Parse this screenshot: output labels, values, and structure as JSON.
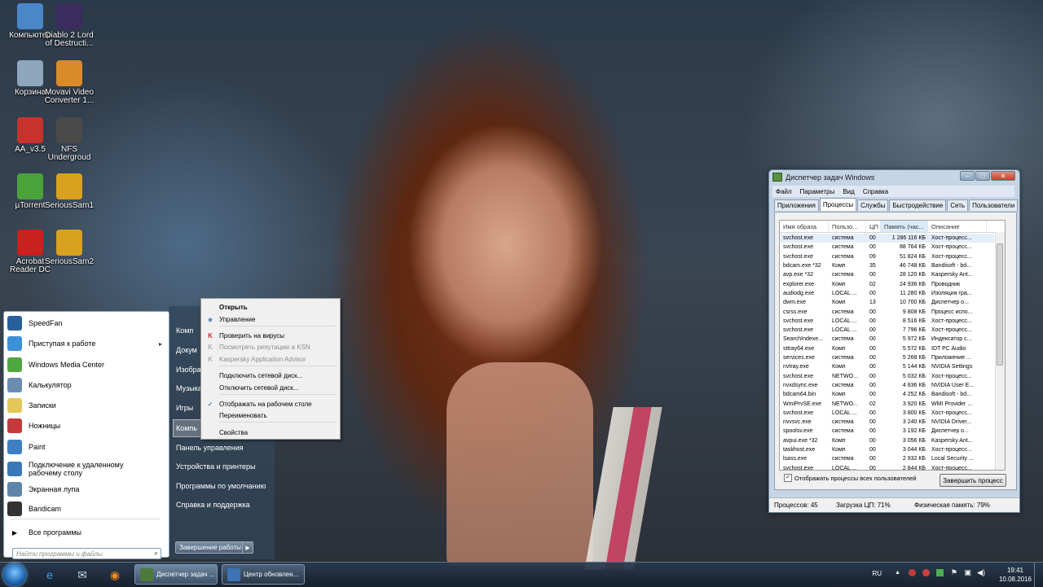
{
  "desktop": {
    "icons": [
      {
        "label": "Компьютер",
        "color": "#4a86c8"
      },
      {
        "label": "Diablo 2 Lord of Destructi...",
        "color": "#3a2c5c"
      },
      {
        "label": "Корзина",
        "color": "#8fa7bd"
      },
      {
        "label": "Movavi Video Converter 1...",
        "color": "#d98a2b"
      },
      {
        "label": "AA_v3.5",
        "color": "#c8322d"
      },
      {
        "label": "NFS Undergroud",
        "color": "#4a4a4a"
      },
      {
        "label": "µTorrent",
        "color": "#4aa33a"
      },
      {
        "label": "SeriousSam1",
        "color": "#d8a21e"
      },
      {
        "label": "Acrobat Reader DC",
        "color": "#c8211e"
      },
      {
        "label": "SeriousSam2",
        "color": "#d8a21e"
      }
    ]
  },
  "start_menu": {
    "programs": [
      {
        "label": "SpeedFan",
        "color": "#2a5f9e"
      },
      {
        "label": "Приступая к работе",
        "color": "#3d8fd6",
        "arrow": "▸"
      },
      {
        "label": "Windows Media Center",
        "color": "#4fa83d"
      },
      {
        "label": "Калькулятор",
        "color": "#6c8bb0"
      },
      {
        "label": "Записки",
        "color": "#e3c75a"
      },
      {
        "label": "Ножницы",
        "color": "#c23b3b"
      },
      {
        "label": "Paint",
        "color": "#3e7fc4"
      },
      {
        "label": "Подключение к удаленному рабочему столу",
        "color": "#3978b8"
      },
      {
        "label": "Экранная лупа",
        "color": "#5d84aa"
      },
      {
        "label": "Bandicam",
        "color": "#333333"
      }
    ],
    "all_programs": "Все программы",
    "search_placeholder": "Найти программы и файлы",
    "right": {
      "items": [
        "Комп",
        "Докум",
        "Изобра",
        "Музыка",
        "Игры",
        "Компь",
        "Панель управления",
        "Устройства и принтеры",
        "Программы по умолчанию",
        "Справка и поддержка"
      ]
    },
    "shutdown": "Завершение работы"
  },
  "context_menu": {
    "items": [
      {
        "label": "Открыть",
        "bold": true
      },
      {
        "label": "Управление",
        "icon": "shield-icon"
      },
      {
        "label": "Проверить на вирусы",
        "icon": "kaspersky-icon"
      },
      {
        "label": "Посмотреть репутацию в KSN",
        "icon": "kaspersky-icon",
        "disabled": true
      },
      {
        "label": "Kaspersky Application Advisor",
        "icon": "kaspersky-icon",
        "disabled": true
      },
      {
        "label": "Подключить сетевой диск..."
      },
      {
        "label": "Отключить сетевой диск..."
      },
      {
        "label": "Отображать на рабочем столе",
        "checked": true
      },
      {
        "label": "Переименовать"
      },
      {
        "label": "Свойства"
      }
    ]
  },
  "task_manager": {
    "title": "Диспетчер задач Windows",
    "menu": [
      "Файл",
      "Параметры",
      "Вид",
      "Справка"
    ],
    "tabs": [
      "Приложения",
      "Процессы",
      "Службы",
      "Быстродействие",
      "Сеть",
      "Пользователи"
    ],
    "active_tab": "Процессы",
    "columns": [
      "Имя образа",
      "Пользо...",
      "ЦП",
      "Память (час...",
      "Описание"
    ],
    "rows": [
      [
        "svchost.exe",
        "система",
        "00",
        "1 286 116 КБ",
        "Хост-процесс..."
      ],
      [
        "svchost.exe",
        "система",
        "00",
        "88 764 КБ",
        "Хост-процесс..."
      ],
      [
        "svchost.exe",
        "система",
        "09",
        "51 824 КБ",
        "Хост-процесс..."
      ],
      [
        "bdcam.exe *32",
        "Комп",
        "35",
        "46 748 КБ",
        "Bandisoft - bd..."
      ],
      [
        "avp.exe *32",
        "система",
        "00",
        "28 120 КБ",
        "Kaspersky Ant..."
      ],
      [
        "explorer.exe",
        "Комп",
        "02",
        "24 936 КБ",
        "Проводник"
      ],
      [
        "audiodg.exe",
        "LOCAL ...",
        "00",
        "11 280 КБ",
        "Изоляция гра..."
      ],
      [
        "dwm.exe",
        "Комп",
        "13",
        "10 700 КБ",
        "Диспетчер о..."
      ],
      [
        "csrss.exe",
        "система",
        "00",
        "9 808 КБ",
        "Процесс испо..."
      ],
      [
        "svchost.exe",
        "LOCAL ...",
        "00",
        "8 516 КБ",
        "Хост-процесс..."
      ],
      [
        "svchost.exe",
        "LOCAL ...",
        "00",
        "7 796 КБ",
        "Хост-процесс..."
      ],
      [
        "SearchIndexe...",
        "система",
        "00",
        "5 972 КБ",
        "Индексатор с..."
      ],
      [
        "sttray64.exe",
        "Комп",
        "00",
        "5 572 КБ",
        "IDT PC Audio"
      ],
      [
        "services.exe",
        "система",
        "00",
        "5 268 КБ",
        "Приложение ..."
      ],
      [
        "nvtray.exe",
        "Комп",
        "00",
        "5 144 КБ",
        "NVIDIA Settings"
      ],
      [
        "svchost.exe",
        "NETWO...",
        "00",
        "5 032 КБ",
        "Хост-процесс..."
      ],
      [
        "nvxdsync.exe",
        "система",
        "00",
        "4 836 КБ",
        "NVIDIA User E..."
      ],
      [
        "bdcam64.bin",
        "Комп",
        "00",
        "4 252 КБ",
        "Bandisoft - bd..."
      ],
      [
        "WmiPrvSE.exe",
        "NETWO...",
        "02",
        "3 920 КБ",
        "WMI Provider ..."
      ],
      [
        "svchost.exe",
        "LOCAL ...",
        "00",
        "3 800 КБ",
        "Хост-процесс..."
      ],
      [
        "nvvsvc.exe",
        "система",
        "00",
        "3 240 КБ",
        "NVIDIA Driver..."
      ],
      [
        "spoolsv.exe",
        "система",
        "00",
        "3 192 КБ",
        "Диспетчер о..."
      ],
      [
        "avpui.exe *32",
        "Комп",
        "00",
        "3 056 КБ",
        "Kaspersky Ant..."
      ],
      [
        "taskhost.exe",
        "Комп",
        "00",
        "3 044 КБ",
        "Хост-процесс..."
      ],
      [
        "lsass.exe",
        "система",
        "00",
        "2 932 КБ",
        "Local Security ..."
      ],
      [
        "svchost.exe",
        "LOCAL ...",
        "00",
        "2 844 КБ",
        "Хост-процесс..."
      ]
    ],
    "show_all_users": "Отображать процессы всех пользователей",
    "end_process": "Завершить процесс",
    "status": {
      "processes": "Процессов: 45",
      "cpu": "Загрузка ЦП: 71%",
      "memory": "Физическая память: 79%"
    }
  },
  "taskbar": {
    "tasks": [
      {
        "label": "Диспетчер задач ...",
        "color": "#4d7a3b"
      },
      {
        "label": "Центр обновлен...",
        "color": "#3b73b3"
      }
    ],
    "tray": {
      "lang": "RU",
      "time": "19:41",
      "date": "10.08.2016"
    }
  }
}
